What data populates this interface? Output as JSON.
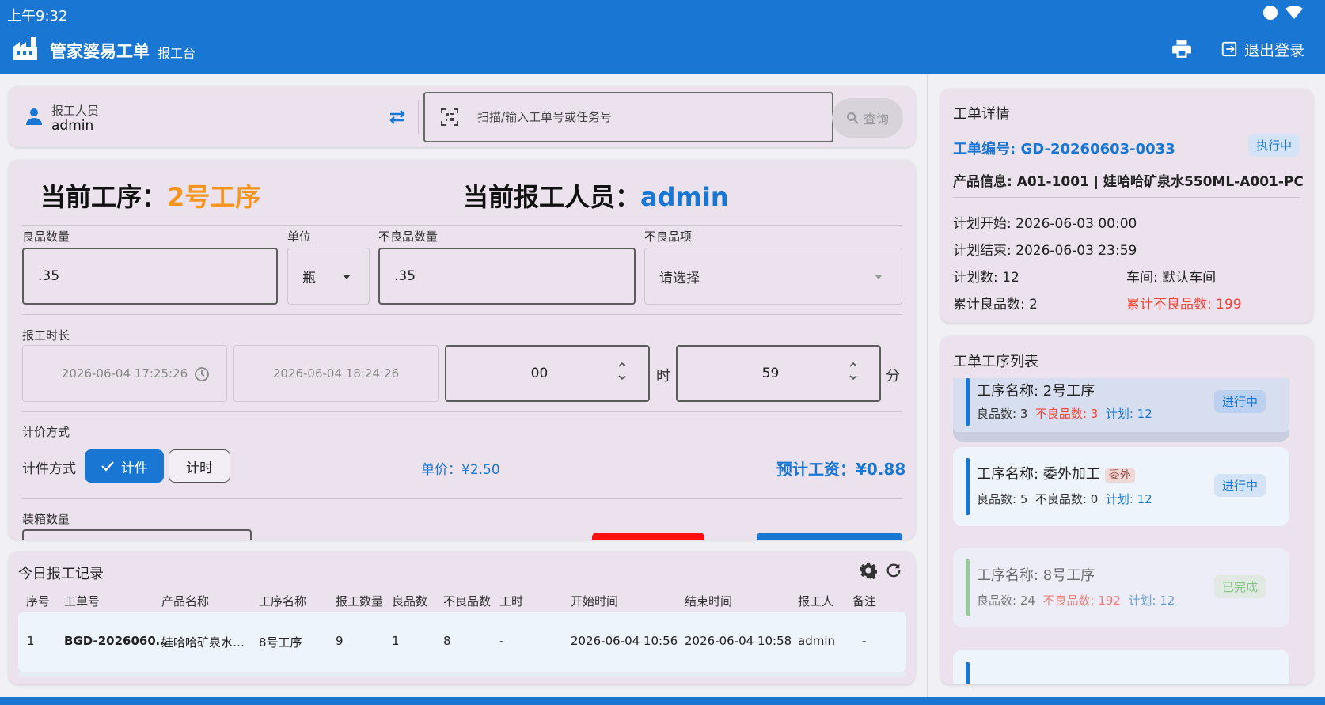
{
  "status_bar": {
    "time": "上午9:32"
  },
  "app_bar": {
    "title": "管家婆易工单",
    "subtitle": "报工台",
    "logout_label": "退出登录"
  },
  "reporter": {
    "label": "报工人员",
    "value": "admin",
    "scan_placeholder": "扫描/输入工单号或任务号",
    "query_label": "查询"
  },
  "form": {
    "current_step_label": "当前工序：",
    "current_step_value": "2号工序",
    "current_worker_label": "当前报工人员：",
    "current_worker_value": "admin",
    "good_qty_label": "良品数量",
    "good_qty_value": ".35",
    "unit_label": "单位",
    "unit_value": "瓶",
    "bad_qty_label": "不良品数量",
    "bad_qty_value": ".35",
    "bad_item_label": "不良品项",
    "bad_item_placeholder": "请选择",
    "duration_label": "报工时长",
    "start_time": "2026-06-04 17:25:26",
    "end_time": "2026-06-04 18:24:26",
    "hours_value": "00",
    "hours_unit": "时",
    "minutes_value": "59",
    "minutes_unit": "分",
    "pricing_section_label": "计价方式",
    "pricing_method_label": "计件方式",
    "piece_label": "计件",
    "time_label": "计时",
    "unit_price": "单价：¥2.50",
    "estimated_wage": "预计工资：¥0.88",
    "box_qty_label": "装箱数量"
  },
  "records": {
    "title": "今日报工记录",
    "columns": [
      "序号",
      "工单号",
      "产品名称",
      "工序名称",
      "报工数量",
      "良品数",
      "不良品数",
      "工时",
      "开始时间",
      "结束时间",
      "报工人",
      "备注"
    ],
    "rows": [
      [
        "1",
        "BGD-2026060…",
        "娃哈哈矿泉水…",
        "8号工序",
        "9",
        "1",
        "8",
        "-",
        "2026-06-04 10:56",
        "2026-06-04 10:58",
        "admin",
        "-"
      ]
    ]
  },
  "detail": {
    "title": "工单详情",
    "order_no": "工单编号: GD-20260603-0033",
    "status": "执行中",
    "product": "产品信息: A01-1001 | 娃哈哈矿泉水550ML-A001-PC",
    "plan_start": "计划开始: 2026-06-03 00:00",
    "plan_end": "计划结束: 2026-06-03 23:59",
    "plan_qty": "计划数: 12",
    "workshop": "车间: 默认车间",
    "total_good": "累计良品数: 2",
    "total_bad": "累计不良品数: 199"
  },
  "processes": {
    "title": "工单工序列表",
    "items": [
      {
        "name": "工序名称: 2号工序",
        "good": "良品数: 3",
        "bad": "不良品数: 3",
        "plan": "计划: 12",
        "status": "进行中",
        "tag": ""
      },
      {
        "name": "工序名称: 委外加工",
        "good": "良品数: 5",
        "bad": "不良品数: 0",
        "plan": "计划: 12",
        "status": "进行中",
        "tag": "委外"
      },
      {
        "name": "工序名称: 8号工序",
        "good": "良品数: 24",
        "bad": "不良品数: 192",
        "plan": "计划: 12",
        "status": "已完成",
        "tag": ""
      }
    ]
  },
  "colors": {
    "primary": "#1976d2",
    "accent_orange": "#f7941d",
    "danger": "#f44336",
    "card_bg": "#ebe2ee"
  }
}
